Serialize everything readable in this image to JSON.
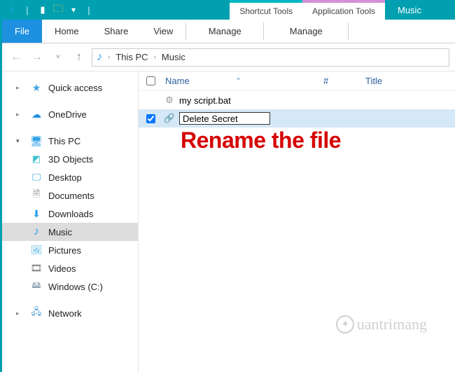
{
  "titlebar": {
    "tool_tab_shortcut": "Shortcut Tools",
    "tool_tab_application": "Application Tools",
    "title": "Music"
  },
  "ribbon": {
    "file": "File",
    "home": "Home",
    "share": "Share",
    "view": "View",
    "manage1": "Manage",
    "manage2": "Manage"
  },
  "breadcrumb": {
    "root": "This PC",
    "folder": "Music"
  },
  "nav": {
    "quick_access": "Quick access",
    "onedrive": "OneDrive",
    "this_pc": "This PC",
    "objects_3d": "3D Objects",
    "desktop": "Desktop",
    "documents": "Documents",
    "downloads": "Downloads",
    "music": "Music",
    "pictures": "Pictures",
    "videos": "Videos",
    "windows_c": "Windows (C:)",
    "network": "Network"
  },
  "columns": {
    "name": "Name",
    "number": "#",
    "title": "Title"
  },
  "files": [
    {
      "name": "my script.bat",
      "checked": false,
      "editing": false
    },
    {
      "name": "Delete Secret",
      "checked": true,
      "editing": true
    }
  ],
  "annotation": "Rename the file",
  "watermark": "uantrimang"
}
